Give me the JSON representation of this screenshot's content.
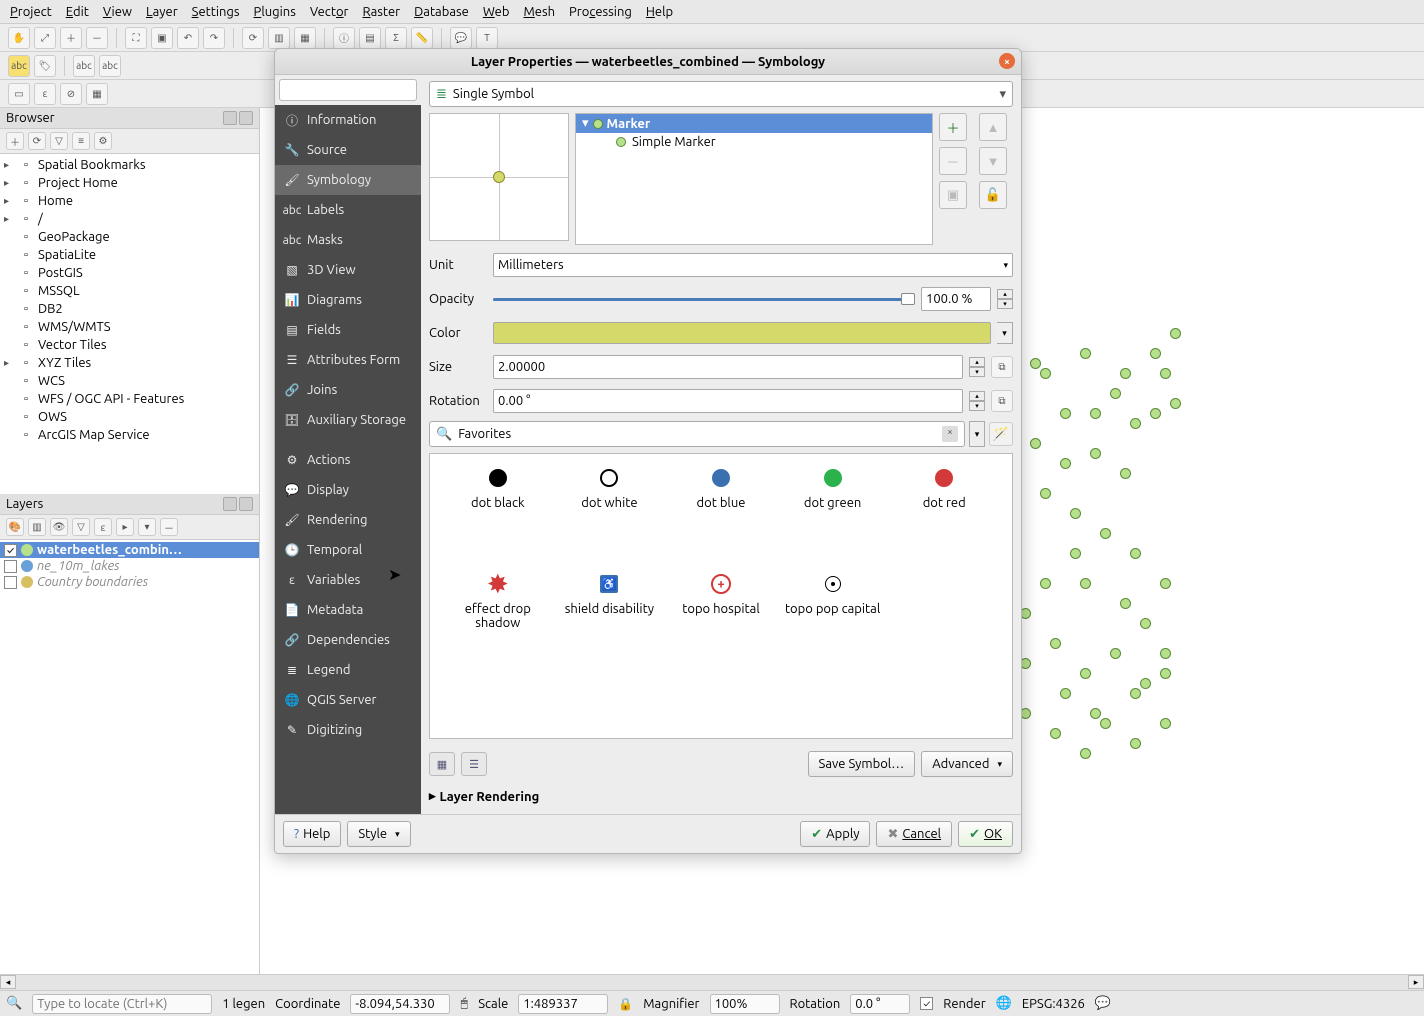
{
  "menu": {
    "project": "Project",
    "edit": "Edit",
    "view": "View",
    "layer": "Layer",
    "settings": "Settings",
    "plugins": "Plugins",
    "vector": "Vector",
    "raster": "Raster",
    "database": "Database",
    "web": "Web",
    "mesh": "Mesh",
    "processing": "Processing",
    "help": "Help"
  },
  "browser": {
    "title": "Browser",
    "items": [
      {
        "label": "Spatial Bookmarks",
        "expandable": true
      },
      {
        "label": "Project Home",
        "expandable": true
      },
      {
        "label": "Home",
        "expandable": true
      },
      {
        "label": "/",
        "expandable": true
      },
      {
        "label": "GeoPackage",
        "expandable": false
      },
      {
        "label": "SpatiaLite",
        "expandable": false
      },
      {
        "label": "PostGIS",
        "expandable": false
      },
      {
        "label": "MSSQL",
        "expandable": false
      },
      {
        "label": "DB2",
        "expandable": false
      },
      {
        "label": "WMS/WMTS",
        "expandable": false
      },
      {
        "label": "Vector Tiles",
        "expandable": false
      },
      {
        "label": "XYZ Tiles",
        "expandable": true
      },
      {
        "label": "WCS",
        "expandable": false
      },
      {
        "label": "WFS / OGC API - Features",
        "expandable": false
      },
      {
        "label": "OWS",
        "expandable": false
      },
      {
        "label": "ArcGIS Map Service",
        "expandable": false
      }
    ]
  },
  "layers": {
    "title": "Layers",
    "items": [
      {
        "checked": true,
        "label": "waterbeetles_combin…",
        "selected": true,
        "color": "#b7e08a"
      },
      {
        "checked": false,
        "label": "ne_10m_lakes",
        "dim": true,
        "color": "#6aa0d8"
      },
      {
        "checked": false,
        "label": "Country boundaries",
        "dim": true,
        "color": "#d8c060"
      }
    ]
  },
  "dialog": {
    "title": "Layer Properties — waterbeetles_combined — Symbology",
    "search_placeholder": "",
    "categories": [
      "Information",
      "Source",
      "Symbology",
      "Labels",
      "Masks",
      "3D View",
      "Diagrams",
      "Fields",
      "Attributes Form",
      "Joins",
      "Auxiliary Storage",
      "",
      "Actions",
      "Display",
      "Rendering",
      "Temporal",
      "Variables",
      "Metadata",
      "Dependencies",
      "Legend",
      "QGIS Server",
      "Digitizing"
    ],
    "selected_category": "Symbology",
    "symbol_type": "Single Symbol",
    "marker_tree": {
      "root": "Marker",
      "child": "Simple Marker"
    },
    "unit_label": "Unit",
    "unit_value": "Millimeters",
    "opacity_label": "Opacity",
    "opacity_value": "100.0 %",
    "color_label": "Color",
    "size_label": "Size",
    "size_value": "2.00000",
    "rotation_label": "Rotation",
    "rotation_value": "0.00 °",
    "favorites_label": "Favorites",
    "symbols": [
      {
        "name": "dot  black",
        "type": "black"
      },
      {
        "name": "dot  white",
        "type": "white"
      },
      {
        "name": "dot blue",
        "type": "blue"
      },
      {
        "name": "dot green",
        "type": "green"
      },
      {
        "name": "dot red",
        "type": "red"
      },
      {
        "name": "effect drop shadow",
        "type": "burst"
      },
      {
        "name": "shield disability",
        "type": "shield"
      },
      {
        "name": "topo hospital",
        "type": "hosp"
      },
      {
        "name": "topo pop capital",
        "type": "pop"
      }
    ],
    "save_symbol": "Save Symbol…",
    "advanced": "Advanced",
    "layer_rendering": "Layer Rendering",
    "help": "Help",
    "style": "Style",
    "apply": "Apply",
    "cancel": "Cancel",
    "ok": "OK"
  },
  "status": {
    "locator_placeholder": "Type to locate (Ctrl+K)",
    "legend": "1 legen",
    "coord_label": "Coordinate",
    "coord": "-8.094,54.330",
    "scale_label": "Scale",
    "scale": "1:489337",
    "magnifier_label": "Magnifier",
    "magnifier": "100%",
    "rotation_label": "Rotation",
    "rotation": "0.0 °",
    "render": "Render",
    "epsg": "EPSG:4326"
  }
}
